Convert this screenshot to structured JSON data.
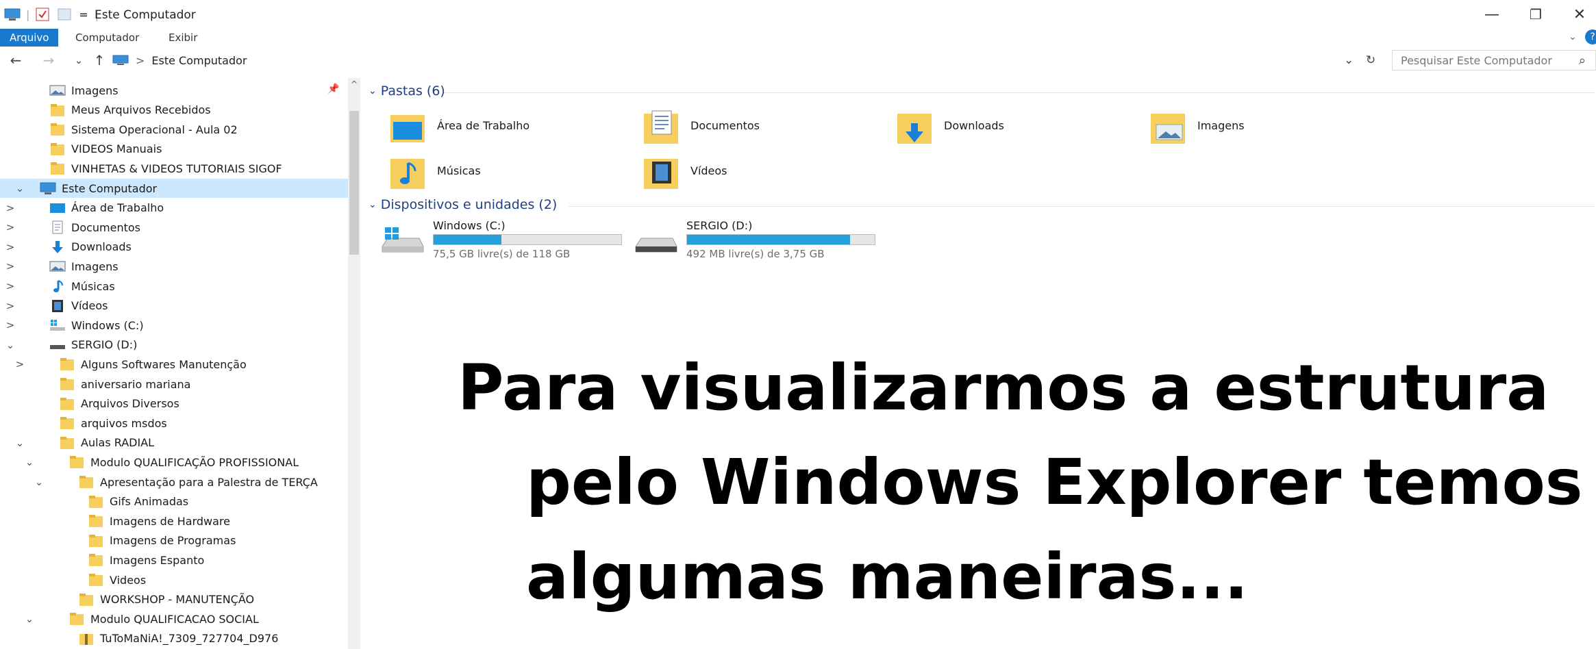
{
  "window": {
    "title": "Este Computador",
    "separator": "|",
    "qa_more": "=",
    "minimize": "—",
    "restore": "❐",
    "close": "✕"
  },
  "ribbon": {
    "tabs": [
      {
        "label": "Arquivo",
        "active": true
      },
      {
        "label": "Computador",
        "active": false
      },
      {
        "label": "Exibir",
        "active": false
      }
    ],
    "expand": "⌄",
    "help": "?"
  },
  "nav": {
    "back": "←",
    "forward": "→",
    "recent": "⌄",
    "up": "↑",
    "breadcrumb_sep": ">",
    "location": "Este Computador",
    "dropdown": "⌄",
    "refresh": "↻",
    "search_placeholder": "Pesquisar Este Computador",
    "search_glyph": "⌕"
  },
  "tree": {
    "pin": "📌",
    "scroll_up": "^",
    "rows": [
      {
        "label": "Imagens",
        "icon": "pictures-icon",
        "indent": 1,
        "chevron": ""
      },
      {
        "label": "Meus Arquivos Recebidos",
        "icon": "folder-icon",
        "indent": 1,
        "chevron": ""
      },
      {
        "label": "Sistema Operacional - Aula 02",
        "icon": "folder-icon",
        "indent": 1,
        "chevron": ""
      },
      {
        "label": "VIDEOS Manuais",
        "icon": "folder-icon",
        "indent": 1,
        "chevron": ""
      },
      {
        "label": "VINHETAS & VIDEOS TUTORIAIS SIGOF",
        "icon": "folder-icon",
        "indent": 1,
        "chevron": ""
      },
      {
        "label": "Este Computador",
        "icon": "computer-icon",
        "indent": 0,
        "chevron": "⌄",
        "selected": true
      },
      {
        "label": "Área de Trabalho",
        "icon": "desktop-icon",
        "indent": 1,
        "chevron": ">"
      },
      {
        "label": "Documentos",
        "icon": "documents-icon",
        "indent": 1,
        "chevron": ">"
      },
      {
        "label": "Downloads",
        "icon": "downloads-icon",
        "indent": 1,
        "chevron": ">"
      },
      {
        "label": "Imagens",
        "icon": "pictures-icon",
        "indent": 1,
        "chevron": ">"
      },
      {
        "label": "Músicas",
        "icon": "music-icon",
        "indent": 1,
        "chevron": ">"
      },
      {
        "label": "Vídeos",
        "icon": "videos-icon",
        "indent": 1,
        "chevron": ">"
      },
      {
        "label": "Windows (C:)",
        "icon": "windows-drive-icon",
        "indent": 1,
        "chevron": ">"
      },
      {
        "label": "SERGIO (D:)",
        "icon": "usb-drive-icon",
        "indent": 1,
        "chevron": "⌄"
      },
      {
        "label": "Alguns Softwares Manutenção",
        "icon": "folder-icon",
        "indent": 2,
        "chevron": ">"
      },
      {
        "label": "aniversario mariana",
        "icon": "folder-icon",
        "indent": 2,
        "chevron": ""
      },
      {
        "label": "Arquivos Diversos",
        "icon": "folder-icon",
        "indent": 2,
        "chevron": ""
      },
      {
        "label": "arquivos msdos",
        "icon": "folder-icon",
        "indent": 2,
        "chevron": ""
      },
      {
        "label": "Aulas RADIAL",
        "icon": "folder-icon",
        "indent": 2,
        "chevron": "⌄"
      },
      {
        "label": "Modulo QUALIFICAÇÃO PROFISSIONAL",
        "icon": "folder-icon",
        "indent": 3,
        "chevron": "⌄"
      },
      {
        "label": "Apresentação para a Palestra de TERÇA",
        "icon": "folder-icon",
        "indent": 4,
        "chevron": "⌄"
      },
      {
        "label": "Gifs Animadas",
        "icon": "folder-icon",
        "indent": 5,
        "chevron": ""
      },
      {
        "label": "Imagens de Hardware",
        "icon": "folder-icon",
        "indent": 5,
        "chevron": ""
      },
      {
        "label": "Imagens de Programas",
        "icon": "folder-icon",
        "indent": 5,
        "chevron": ""
      },
      {
        "label": "Imagens Espanto",
        "icon": "folder-icon",
        "indent": 5,
        "chevron": ""
      },
      {
        "label": "Videos",
        "icon": "folder-icon",
        "indent": 5,
        "chevron": ""
      },
      {
        "label": "WORKSHOP - MANUTENÇÃO",
        "icon": "folder-icon",
        "indent": 4,
        "chevron": ""
      },
      {
        "label": "Modulo QUALIFICACAO SOCIAL",
        "icon": "folder-icon",
        "indent": 3,
        "chevron": "⌄"
      },
      {
        "label": "TuToMaNiA!_7309_727704_D976",
        "icon": "zip-folder-icon",
        "indent": 4,
        "chevron": ""
      }
    ]
  },
  "content": {
    "folders_header": "Pastas (6)",
    "folders_chevron": "⌄",
    "folders": [
      {
        "label": "Área de Trabalho",
        "icon": "desktop-folder-icon"
      },
      {
        "label": "Documentos",
        "icon": "documents-folder-icon"
      },
      {
        "label": "Downloads",
        "icon": "downloads-folder-icon"
      },
      {
        "label": "Imagens",
        "icon": "pictures-folder-icon"
      },
      {
        "label": "Músicas",
        "icon": "music-folder-icon"
      },
      {
        "label": "Vídeos",
        "icon": "videos-folder-icon"
      }
    ],
    "devices_header": "Dispositivos e unidades (2)",
    "devices_chevron": "⌄",
    "drives": [
      {
        "name": "Windows (C:)",
        "free_text": "75,5 GB livre(s) de 118 GB",
        "used_fraction": 0.36,
        "icon": "windows-drive-icon"
      },
      {
        "name": "SERGIO (D:)",
        "free_text": "492 MB livre(s) de 3,75 GB",
        "used_fraction": 0.87,
        "icon": "usb-drive-icon"
      }
    ]
  },
  "headline": {
    "line1": "Para visualizarmos a estrutura",
    "line2": "pelo Windows Explorer temos",
    "line3": "algumas maneiras..."
  },
  "colors": {
    "accent": "#1979ca",
    "selection": "#cce8ff",
    "drive_bar": "#26a0da",
    "folder": "#f6cf5f",
    "group_header": "#1e3f80"
  }
}
